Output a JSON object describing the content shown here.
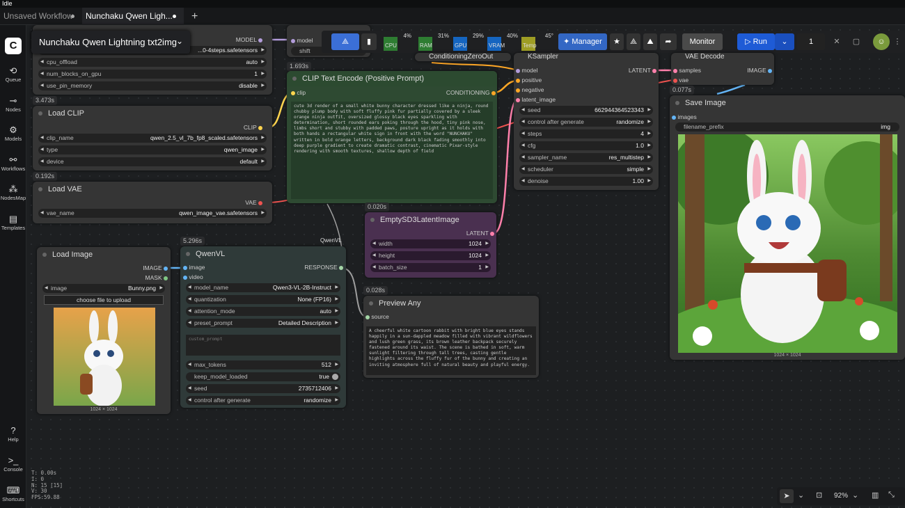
{
  "app": {
    "status": "Idle"
  },
  "tabs": [
    {
      "label": "Unsaved Workflow"
    },
    {
      "label": "Nunchaku Qwen Ligh..."
    }
  ],
  "sidebar": [
    {
      "label": "Queue"
    },
    {
      "label": "Nodes"
    },
    {
      "label": "Models"
    },
    {
      "label": "Workflows"
    },
    {
      "label": "NodesMap"
    },
    {
      "label": "Templates"
    },
    {
      "label": "Help"
    },
    {
      "label": "Console"
    },
    {
      "label": "Shortcuts"
    }
  ],
  "workflow": {
    "title": "Nunchaku Qwen Lightning txt2img"
  },
  "toolbar": {
    "monitors": [
      {
        "label": "CPU",
        "value": "4%",
        "color": "#2e7d32"
      },
      {
        "label": "RAM",
        "value": "31%",
        "color": "#2e7d32"
      },
      {
        "label": "GPU",
        "value": "29%",
        "color": "#1565c0"
      },
      {
        "label": "VRAM",
        "value": "40%",
        "color": "#1565c0"
      },
      {
        "label": "Temp",
        "value": "45°",
        "color": "#9e9d24"
      }
    ],
    "manager": "Manager",
    "monitor": "Monitor",
    "run": "Run",
    "queue_count": "1",
    "zoom": "92%"
  },
  "nodes": {
    "model_loader": {
      "model_out": "MODEL",
      "file": "...0-4steps.safetensors",
      "cpu_offload": {
        "label": "cpu_offload",
        "value": "auto"
      },
      "num_blocks": {
        "label": "num_blocks_on_gpu",
        "value": "1"
      },
      "pin": {
        "label": "use_pin_memory",
        "value": "disable"
      }
    },
    "model_sampling": {
      "model": "model",
      "shift": "shift"
    },
    "load_clip": {
      "time": "3.473s",
      "title": "Load CLIP",
      "out": "CLIP",
      "clip_name": {
        "label": "clip_name",
        "value": "qwen_2.5_vl_7b_fp8_scaled.safetensors"
      },
      "type": {
        "label": "type",
        "value": "qwen_image"
      },
      "device": {
        "label": "device",
        "value": "default"
      }
    },
    "load_vae": {
      "time": "0.192s",
      "title": "Load VAE",
      "out": "VAE",
      "vae_name": {
        "label": "vae_name",
        "value": "qwen_image_vae.safetensors"
      }
    },
    "clip_text": {
      "time": "1.693s",
      "title": "CLIP Text Encode (Positive Prompt)",
      "in": "clip",
      "out": "CONDITIONING",
      "text": "cute 3d render of a small white bunny character dressed like a ninja, round chubby plump body with soft fluffy pink fur partially covered by a sleek orange ninja outfit, oversized glossy black eyes sparkling with determination, short rounded ears poking through the hood, tiny pink nose, limbs short and stubby with padded paws, posture upright as it holds with both hands a rectangular white sign in front with the word \"NUNCHAKU\" written in bold orange letters, background dark black fading smoothly into deep purple gradient to create dramatic contrast, cinematic Pixar-style rendering with smooth textures, shallow depth of field"
    },
    "cond_zero": {
      "title": "ConditioningZeroOut"
    },
    "ksampler": {
      "title": "KSampler",
      "out": "LATENT",
      "inputs": [
        "model",
        "positive",
        "negative",
        "latent_image"
      ],
      "seed": {
        "label": "seed",
        "value": "662944364523343"
      },
      "control": {
        "label": "control after generate",
        "value": "randomize"
      },
      "steps": {
        "label": "steps",
        "value": "4"
      },
      "cfg": {
        "label": "cfg",
        "value": "1.0"
      },
      "sampler": {
        "label": "sampler_name",
        "value": "res_multistep"
      },
      "scheduler": {
        "label": "scheduler",
        "value": "simple"
      },
      "denoise": {
        "label": "denoise",
        "value": "1.00"
      }
    },
    "vae_decode": {
      "title": "VAE Decode",
      "samples": "samples",
      "vae": "vae",
      "out": "IMAGE",
      "time": "0.077s"
    },
    "save_image": {
      "title": "Save Image",
      "in": "images",
      "prefix": {
        "label": "filename_prefix",
        "value": "img"
      },
      "size": "1024 × 1024"
    },
    "empty_latent": {
      "time": "0.020s",
      "title": "EmptySD3LatentImage",
      "out": "LATENT",
      "width": {
        "label": "width",
        "value": "1024"
      },
      "height": {
        "label": "height",
        "value": "1024"
      },
      "batch": {
        "label": "batch_size",
        "value": "1"
      }
    },
    "load_image": {
      "title": "Load Image",
      "image_out": "IMAGE",
      "mask_out": "MASK",
      "image": {
        "label": "image",
        "value": "Bunny.png"
      },
      "upload": "choose file to upload",
      "size": "1024 × 1024"
    },
    "qwenvl": {
      "time": "5.296s",
      "title": "QwenVL",
      "link_label": "QwenVL",
      "image_in": "image",
      "video_in": "video",
      "out": "RESPONSE",
      "model_name": {
        "label": "model_name",
        "value": "Qwen3-VL-2B-Instruct"
      },
      "quant": {
        "label": "quantization",
        "value": "None (FP16)"
      },
      "attn": {
        "label": "attention_mode",
        "value": "auto"
      },
      "preset": {
        "label": "preset_prompt",
        "value": "Detailed Description"
      },
      "custom_placeholder": "custom_prompt",
      "max_tokens": {
        "label": "max_tokens",
        "value": "512"
      },
      "keep": {
        "label": "keep_model_loaded",
        "value": "true"
      },
      "seed": {
        "label": "seed",
        "value": "2735712406"
      },
      "control": {
        "label": "control after generate",
        "value": "randomize"
      }
    },
    "preview_any": {
      "time": "0.028s",
      "title": "Preview Any",
      "in": "source",
      "text": "A cheerful white cartoon rabbit with bright blue eyes stands happily in a sun-dappled meadow filled with vibrant wildflowers and lush green grass, its brown leather backpack securely fastened around its waist. The scene is bathed in soft, warm sunlight filtering through tall trees, casting gentle highlights across the fluffy fur of the bunny and creating an inviting atmosphere full of natural beauty and playful energy."
    }
  },
  "stats": {
    "t": "T: 0.00s",
    "i": "I: 0",
    "n": "N: 15 [15]",
    "v": "V: 30",
    "fps": "FPS:59.88"
  }
}
